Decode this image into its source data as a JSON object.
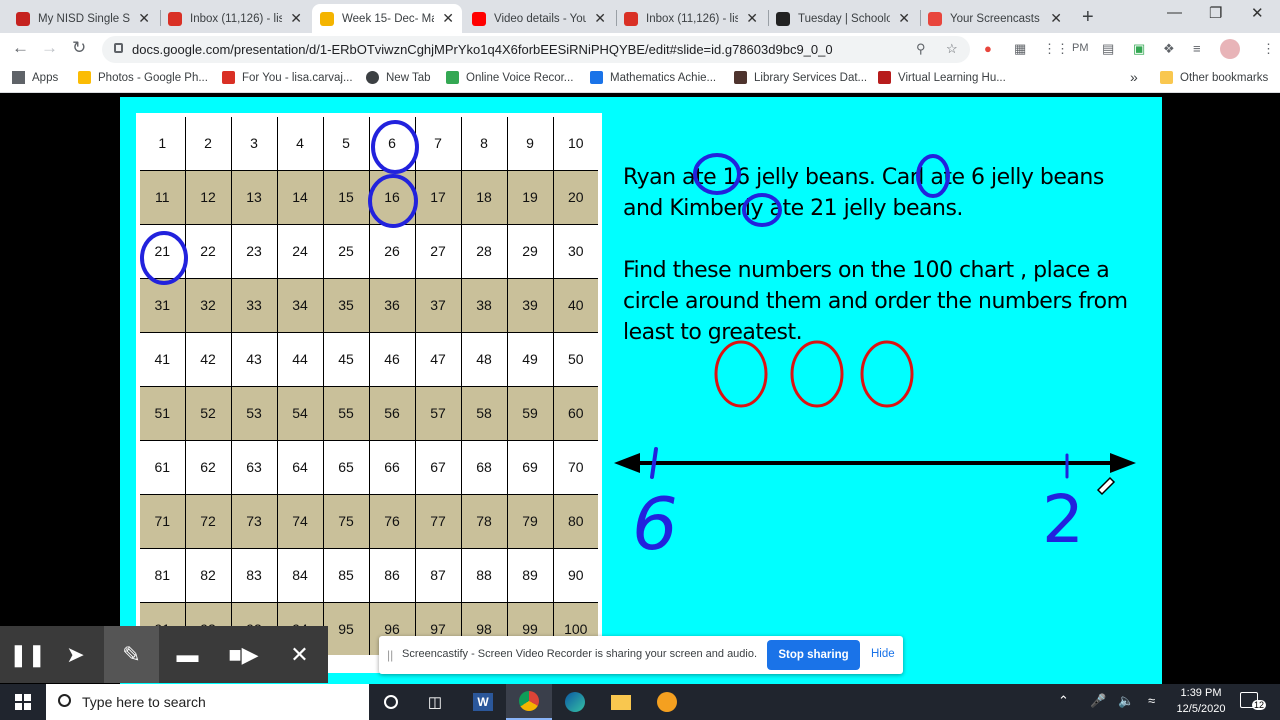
{
  "tabs": [
    {
      "title": "My NISD Single Si",
      "icon": "nisd-icon",
      "color": "#c5221f"
    },
    {
      "title": "Inbox (11,126) - lis",
      "icon": "gmail-icon",
      "color": "#d93025"
    },
    {
      "title": "Week 15- Dec- Ma",
      "icon": "slides-icon",
      "color": "#f4b400",
      "active": true
    },
    {
      "title": "Video details - You",
      "icon": "youtube-icon",
      "color": "#ff0000"
    },
    {
      "title": "Inbox (11,126) - lis",
      "icon": "gmail-icon",
      "color": "#d93025"
    },
    {
      "title": "Tuesday | Schoolo",
      "icon": "schoology-icon",
      "color": "#222222"
    },
    {
      "title": "Your Screencasts -",
      "icon": "screencastify-icon",
      "color": "#e8453c"
    }
  ],
  "address": "docs.google.com/presentation/d/1-ERbOTviwznCghjMPrYko1q4X6forbEESiRNiPHQYBE/edit#slide=id.g78603d9bc9_0_0",
  "ext_label": "PM",
  "bookmarks": [
    {
      "label": "Apps",
      "color": "#5f6368"
    },
    {
      "label": "Photos - Google Ph...",
      "color": "#fbbc04"
    },
    {
      "label": "For You - lisa.carvaj...",
      "color": "#d93025"
    },
    {
      "label": "New Tab",
      "color": "#3c4043"
    },
    {
      "label": "Online Voice Recor...",
      "color": "#34a853"
    },
    {
      "label": "Mathematics Achie...",
      "color": "#1a73e8"
    },
    {
      "label": "Library Services Dat...",
      "color": "#4e342e"
    },
    {
      "label": "Virtual Learning Hu...",
      "color": "#b71c1c"
    }
  ],
  "bookmarks_more": "»",
  "other_bookmarks": "Other bookmarks",
  "hundred_chart": [
    [
      "1",
      "2",
      "3",
      "4",
      "5",
      "6",
      "7",
      "8",
      "9",
      "10"
    ],
    [
      "11",
      "12",
      "13",
      "14",
      "15",
      "16",
      "17",
      "18",
      "19",
      "20"
    ],
    [
      "21",
      "22",
      "23",
      "24",
      "25",
      "26",
      "27",
      "28",
      "29",
      "30"
    ],
    [
      "31",
      "32",
      "33",
      "34",
      "35",
      "36",
      "37",
      "38",
      "39",
      "40"
    ],
    [
      "41",
      "42",
      "43",
      "44",
      "45",
      "46",
      "47",
      "48",
      "49",
      "50"
    ],
    [
      "51",
      "52",
      "53",
      "54",
      "55",
      "56",
      "57",
      "58",
      "59",
      "60"
    ],
    [
      "61",
      "62",
      "63",
      "64",
      "65",
      "66",
      "67",
      "68",
      "69",
      "70"
    ],
    [
      "71",
      "72",
      "73",
      "74",
      "75",
      "76",
      "77",
      "78",
      "79",
      "80"
    ],
    [
      "81",
      "82",
      "83",
      "84",
      "85",
      "86",
      "87",
      "88",
      "89",
      "90"
    ],
    [
      "91",
      "92",
      "93",
      "94",
      "95",
      "96",
      "97",
      "98",
      "99",
      "100"
    ]
  ],
  "circled_numbers": [
    "6",
    "16",
    "21"
  ],
  "problem": {
    "line1": "Ryan ate 16 jelly beans. Carl ate 6 jelly beans and Kimberly ate 21 jelly beans.",
    "line2": "Find these numbers on the 100 chart , place a circle around them and order the numbers from least to greatest."
  },
  "handwriting": {
    "left_number": "6",
    "right_number": "2"
  },
  "recorder_tools": [
    "pause-icon",
    "pointer-icon",
    "pen-icon",
    "eraser-icon",
    "camera-icon",
    "close-icon"
  ],
  "share_notice": {
    "grip": "||",
    "message": "Screencastify - Screen Video Recorder is sharing your screen and audio.",
    "stop": "Stop sharing",
    "hide": "Hide"
  },
  "taskbar": {
    "search_placeholder": "Type here to search",
    "time": "1:39 PM",
    "date": "12/5/2020",
    "notifications": "12"
  },
  "colors": {
    "slide_bg": "#00ffff",
    "shaded_row": "#c9c09a",
    "pen_blue": "#2222dd",
    "pen_red": "#dd1111"
  }
}
